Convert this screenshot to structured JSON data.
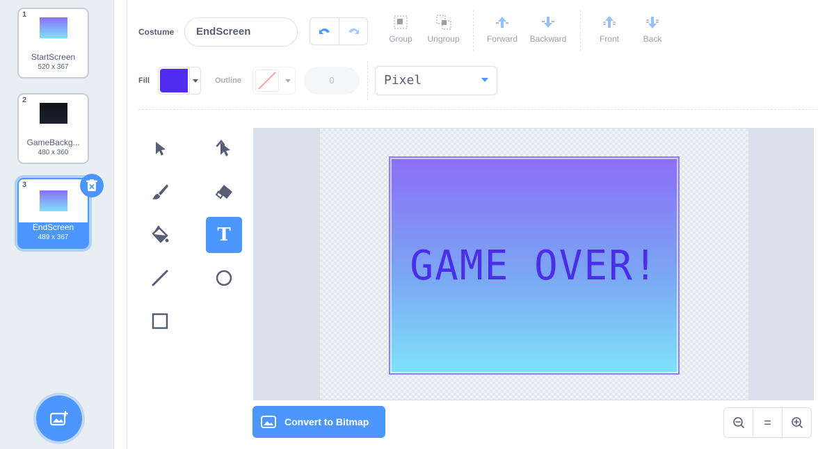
{
  "costumes": [
    {
      "num": "1",
      "name": "StartScreen",
      "dims": "520 x 367",
      "thumb_colors": [
        "#8b6ff6",
        "#80e0f8"
      ]
    },
    {
      "num": "2",
      "name": "GameBackg...",
      "dims": "480 x 360",
      "thumb_colors": [
        "#111418",
        "#1a2230"
      ]
    },
    {
      "num": "3",
      "name": "EndScreen",
      "dims": "489 x 367",
      "thumb_colors": [
        "#8b6ff6",
        "#80e0f8"
      ],
      "selected": true
    }
  ],
  "toolbar": {
    "costume_label": "Costume",
    "costume_name": "EndScreen",
    "group_label": "Group",
    "ungroup_label": "Ungroup",
    "forward_label": "Forward",
    "backward_label": "Backward",
    "front_label": "Front",
    "back_label": "Back",
    "fill_label": "Fill",
    "fill_color": "#4f2cf0",
    "outline_label": "Outline",
    "outline_width": "0",
    "font": "Pixel"
  },
  "canvas": {
    "art_text": "GAME OVER!"
  },
  "bottom": {
    "convert_label": "Convert to Bitmap",
    "zoom_reset_label": "="
  },
  "colors": {
    "accent": "#4c97ff",
    "text": "#575e75"
  }
}
